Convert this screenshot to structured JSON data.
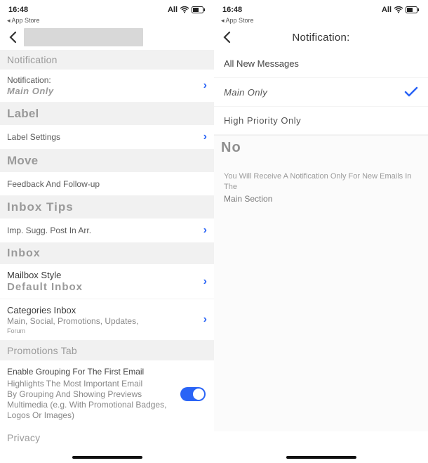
{
  "status": {
    "time": "16:48",
    "carrier": "All",
    "back_app": "App Store"
  },
  "left": {
    "sections": {
      "notification_head": "Notification",
      "notification_row_title": "Notification:",
      "notification_row_sub": "Main Only",
      "label_head": "Label",
      "label_settings": "Label Settings",
      "move_head": "Move",
      "feedback": "Feedback And Follow-up",
      "inbox_tips_head": "Inbox Tips",
      "imp_sugg": "Imp. Sugg. Post In Arr.",
      "inbox_head": "Inbox",
      "mailbox_style": "Mailbox Style",
      "mailbox_style_sub": "Default Inbox",
      "categories_inbox": "Categories Inbox",
      "categories_sub": "Main, Social, Promotions, Updates,",
      "categories_sub2": "Forum",
      "promotions_head": "Promotions Tab",
      "group_title": "Enable Grouping For The First Email",
      "group_desc1": "Highlights The Most Important Email",
      "group_desc2": "By Grouping And Showing Previews",
      "group_desc3": "Multimedia (e.g. With Promotional Badges,",
      "group_desc4": "Logos Or Images)",
      "privacy": "Privacy"
    }
  },
  "right": {
    "title": "Notification:",
    "options": {
      "all_new": "All New Messages",
      "main_only": "Main Only",
      "high_priority": "High Priority Only",
      "no": "No"
    },
    "explain_line1": "You Will Receive A Notification Only For New Emails In The",
    "explain_line2": "Main Section"
  }
}
